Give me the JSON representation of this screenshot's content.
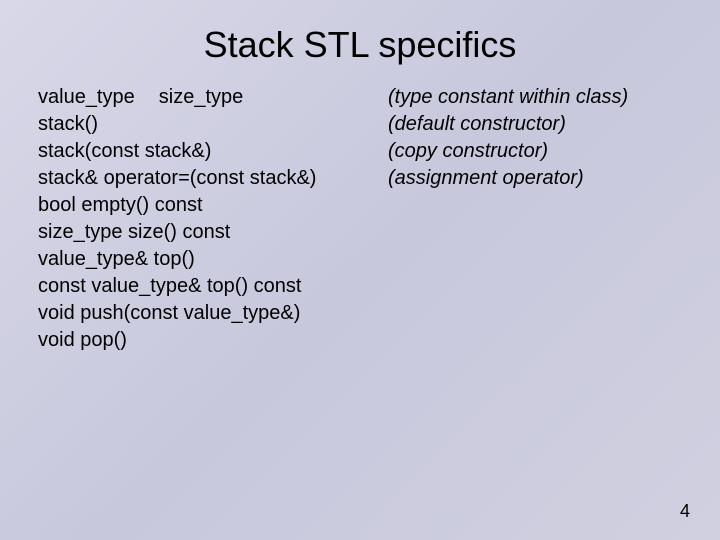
{
  "title": "Stack STL specifics",
  "rows": [
    {
      "left_a": "value_type",
      "left_b": "size_type",
      "right": "(type constant within class)"
    },
    {
      "left": "stack()",
      "right": "(default constructor)"
    },
    {
      "left": "stack(const stack&)",
      "right": "(copy constructor)"
    },
    {
      "left": "stack& operator=(const stack&)",
      "right": "(assignment operator)"
    },
    {
      "left": "bool empty() const",
      "right": ""
    },
    {
      "left": "size_type size() const",
      "right": ""
    },
    {
      "left": "value_type& top()",
      "right": ""
    },
    {
      "left": "const value_type& top() const",
      "right": ""
    },
    {
      "left": "void push(const value_type&)",
      "right": ""
    },
    {
      "left": "void pop()",
      "right": ""
    }
  ],
  "page_number": "4"
}
